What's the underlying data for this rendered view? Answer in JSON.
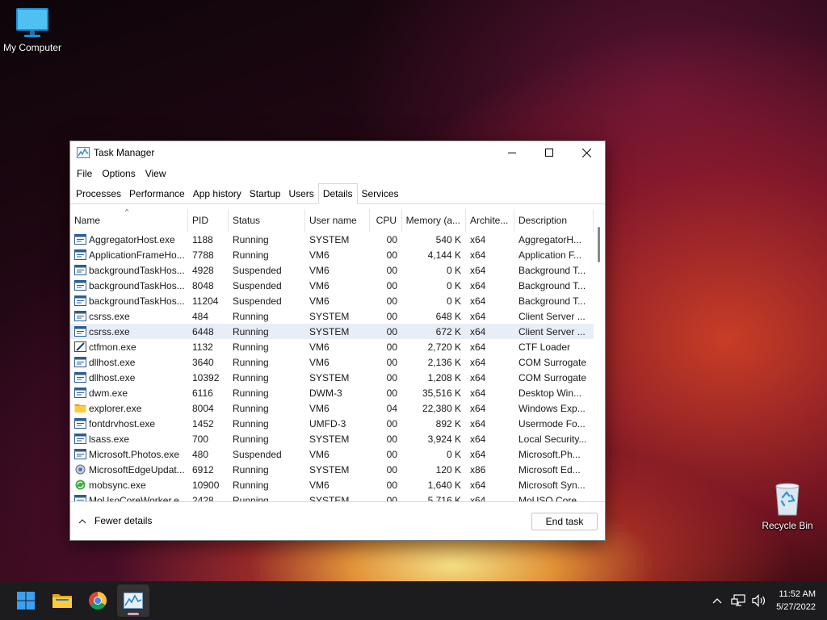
{
  "desktop": {
    "icons": [
      {
        "label": "My Computer",
        "icon": "monitor-icon"
      },
      {
        "label": "Recycle Bin",
        "icon": "recycle-bin-icon"
      }
    ]
  },
  "window": {
    "title": "Task Manager",
    "menu": [
      "File",
      "Options",
      "View"
    ],
    "tabs": [
      "Processes",
      "Performance",
      "App history",
      "Startup",
      "Users",
      "Details",
      "Services"
    ],
    "active_tab": "Details",
    "columns": [
      "Name",
      "PID",
      "Status",
      "User name",
      "CPU",
      "Memory (a...",
      "Archite...",
      "Description"
    ],
    "sorted_column": "Name",
    "rows": [
      {
        "name": "AggregatorHost.exe",
        "pid": "1188",
        "status": "Running",
        "user": "SYSTEM",
        "cpu": "00",
        "mem": "540 K",
        "arch": "x64",
        "desc": "AggregatorH...",
        "icon": "app-window-icon"
      },
      {
        "name": "ApplicationFrameHo...",
        "pid": "7788",
        "status": "Running",
        "user": "VM6",
        "cpu": "00",
        "mem": "4,144 K",
        "arch": "x64",
        "desc": "Application F...",
        "icon": "app-window-icon"
      },
      {
        "name": "backgroundTaskHos...",
        "pid": "4928",
        "status": "Suspended",
        "user": "VM6",
        "cpu": "00",
        "mem": "0 K",
        "arch": "x64",
        "desc": "Background T...",
        "icon": "app-window-icon"
      },
      {
        "name": "backgroundTaskHos...",
        "pid": "8048",
        "status": "Suspended",
        "user": "VM6",
        "cpu": "00",
        "mem": "0 K",
        "arch": "x64",
        "desc": "Background T...",
        "icon": "app-window-icon"
      },
      {
        "name": "backgroundTaskHos...",
        "pid": "11204",
        "status": "Suspended",
        "user": "VM6",
        "cpu": "00",
        "mem": "0 K",
        "arch": "x64",
        "desc": "Background T...",
        "icon": "app-window-icon"
      },
      {
        "name": "csrss.exe",
        "pid": "484",
        "status": "Running",
        "user": "SYSTEM",
        "cpu": "00",
        "mem": "648 K",
        "arch": "x64",
        "desc": "Client Server ...",
        "icon": "app-window-icon"
      },
      {
        "name": "csrss.exe",
        "pid": "6448",
        "status": "Running",
        "user": "SYSTEM",
        "cpu": "00",
        "mem": "672 K",
        "arch": "x64",
        "desc": "Client Server ...",
        "icon": "app-window-icon",
        "selected": true
      },
      {
        "name": "ctfmon.exe",
        "pid": "1132",
        "status": "Running",
        "user": "VM6",
        "cpu": "00",
        "mem": "2,720 K",
        "arch": "x64",
        "desc": "CTF Loader",
        "icon": "pen-icon"
      },
      {
        "name": "dllhost.exe",
        "pid": "3640",
        "status": "Running",
        "user": "VM6",
        "cpu": "00",
        "mem": "2,136 K",
        "arch": "x64",
        "desc": "COM Surrogate",
        "icon": "app-window-icon"
      },
      {
        "name": "dllhost.exe",
        "pid": "10392",
        "status": "Running",
        "user": "SYSTEM",
        "cpu": "00",
        "mem": "1,208 K",
        "arch": "x64",
        "desc": "COM Surrogate",
        "icon": "app-window-icon"
      },
      {
        "name": "dwm.exe",
        "pid": "6116",
        "status": "Running",
        "user": "DWM-3",
        "cpu": "00",
        "mem": "35,516 K",
        "arch": "x64",
        "desc": "Desktop Win...",
        "icon": "app-window-icon"
      },
      {
        "name": "explorer.exe",
        "pid": "8004",
        "status": "Running",
        "user": "VM6",
        "cpu": "04",
        "mem": "22,380 K",
        "arch": "x64",
        "desc": "Windows Exp...",
        "icon": "folder-icon"
      },
      {
        "name": "fontdrvhost.exe",
        "pid": "1452",
        "status": "Running",
        "user": "UMFD-3",
        "cpu": "00",
        "mem": "892 K",
        "arch": "x64",
        "desc": "Usermode Fo...",
        "icon": "app-window-icon"
      },
      {
        "name": "lsass.exe",
        "pid": "700",
        "status": "Running",
        "user": "SYSTEM",
        "cpu": "00",
        "mem": "3,924 K",
        "arch": "x64",
        "desc": "Local Security...",
        "icon": "app-window-icon"
      },
      {
        "name": "Microsoft.Photos.exe",
        "pid": "480",
        "status": "Suspended",
        "user": "VM6",
        "cpu": "00",
        "mem": "0 K",
        "arch": "x64",
        "desc": "Microsoft.Ph...",
        "icon": "app-window-icon"
      },
      {
        "name": "MicrosoftEdgeUpdat...",
        "pid": "6912",
        "status": "Running",
        "user": "SYSTEM",
        "cpu": "00",
        "mem": "120 K",
        "arch": "x86",
        "desc": "Microsoft Ed...",
        "icon": "installer-icon"
      },
      {
        "name": "mobsync.exe",
        "pid": "10900",
        "status": "Running",
        "user": "VM6",
        "cpu": "00",
        "mem": "1,640 K",
        "arch": "x64",
        "desc": "Microsoft Syn...",
        "icon": "sync-icon"
      },
      {
        "name": "MoUsoCoreWorker.e...",
        "pid": "2428",
        "status": "Running",
        "user": "SYSTEM",
        "cpu": "00",
        "mem": "5,716 K",
        "arch": "x64",
        "desc": "MoUSO Core ...",
        "icon": "app-window-icon"
      }
    ],
    "footer": {
      "fewer_details": "Fewer details",
      "end_task": "End task"
    }
  },
  "taskbar": {
    "apps": [
      "start-icon",
      "file-explorer-icon",
      "chrome-icon",
      "task-manager-icon"
    ],
    "tray": [
      "chevron-up-icon",
      "network-icon",
      "volume-icon"
    ],
    "time": "11:52 AM",
    "date": "5/27/2022"
  },
  "colors": {
    "selected_row": "#e8eef7",
    "taskbar": "#1c1c1e",
    "accent_indicator": "#d6a2c4"
  }
}
